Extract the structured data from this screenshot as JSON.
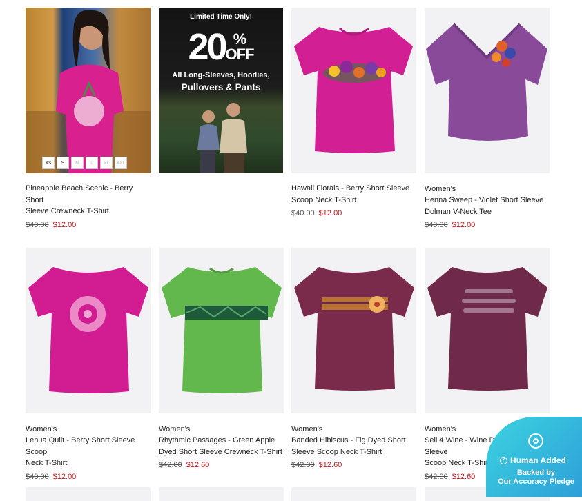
{
  "promo": {
    "line1": "Limited Time Only!",
    "big": "20",
    "pct": "%",
    "off": "OFF",
    "line3": "All Long-Sleeves, Hoodies,",
    "line4": "Pullovers & Pants"
  },
  "sizes": [
    "XS",
    "S",
    "M",
    "L",
    "XL",
    "XXL"
  ],
  "products": [
    {
      "category": "",
      "title1": "Pineapple Beach Scenic - Berry Short",
      "title2": "Sleeve Crewneck T-Shirt",
      "old": "$40.00",
      "new": "$12.00",
      "color": "#d9208f"
    },
    {
      "category": "",
      "title1": "Hawaii Florals - Berry Short Sleeve",
      "title2": "Scoop Neck T-Shirt",
      "old": "$40.00",
      "new": "$12.00",
      "color": "#d21f94"
    },
    {
      "category": "Women's",
      "title1": "Henna Sweep - Violet Short Sleeve",
      "title2": "Dolman V-Neck Tee",
      "old": "$40.00",
      "new": "$12.00",
      "color": "#8a4a9a"
    },
    {
      "category": "Women's",
      "title1": "Lehua Quilt - Berry Short Sleeve Scoop",
      "title2": "Neck T-Shirt",
      "old": "$40.00",
      "new": "$12.00",
      "color": "#d11c92"
    },
    {
      "category": "Women's",
      "title1": "Rhythmic Passages - Green Apple",
      "title2": "Dyed Short Sleeve Crewneck T-Shirt",
      "old": "$42.00",
      "new": "$12.60",
      "color": "#62b84c"
    },
    {
      "category": "Women's",
      "title1": "Banded Hibiscus - Fig Dyed Short",
      "title2": "Sleeve Scoop Neck T-Shirt",
      "old": "$42.00",
      "new": "$12.60",
      "color": "#7a2a4a"
    },
    {
      "category": "Women's",
      "title1": "Sell 4 Wine - Wine Dyed Short Sleeve",
      "title2": "Scoop Neck T-Shirt",
      "old": "$42.00",
      "new": "$12.60",
      "color": "#6e2a48"
    }
  ],
  "badge": {
    "label": "Human Added",
    "line1": "Backed by",
    "line2": "Our Accuracy Pledge"
  }
}
